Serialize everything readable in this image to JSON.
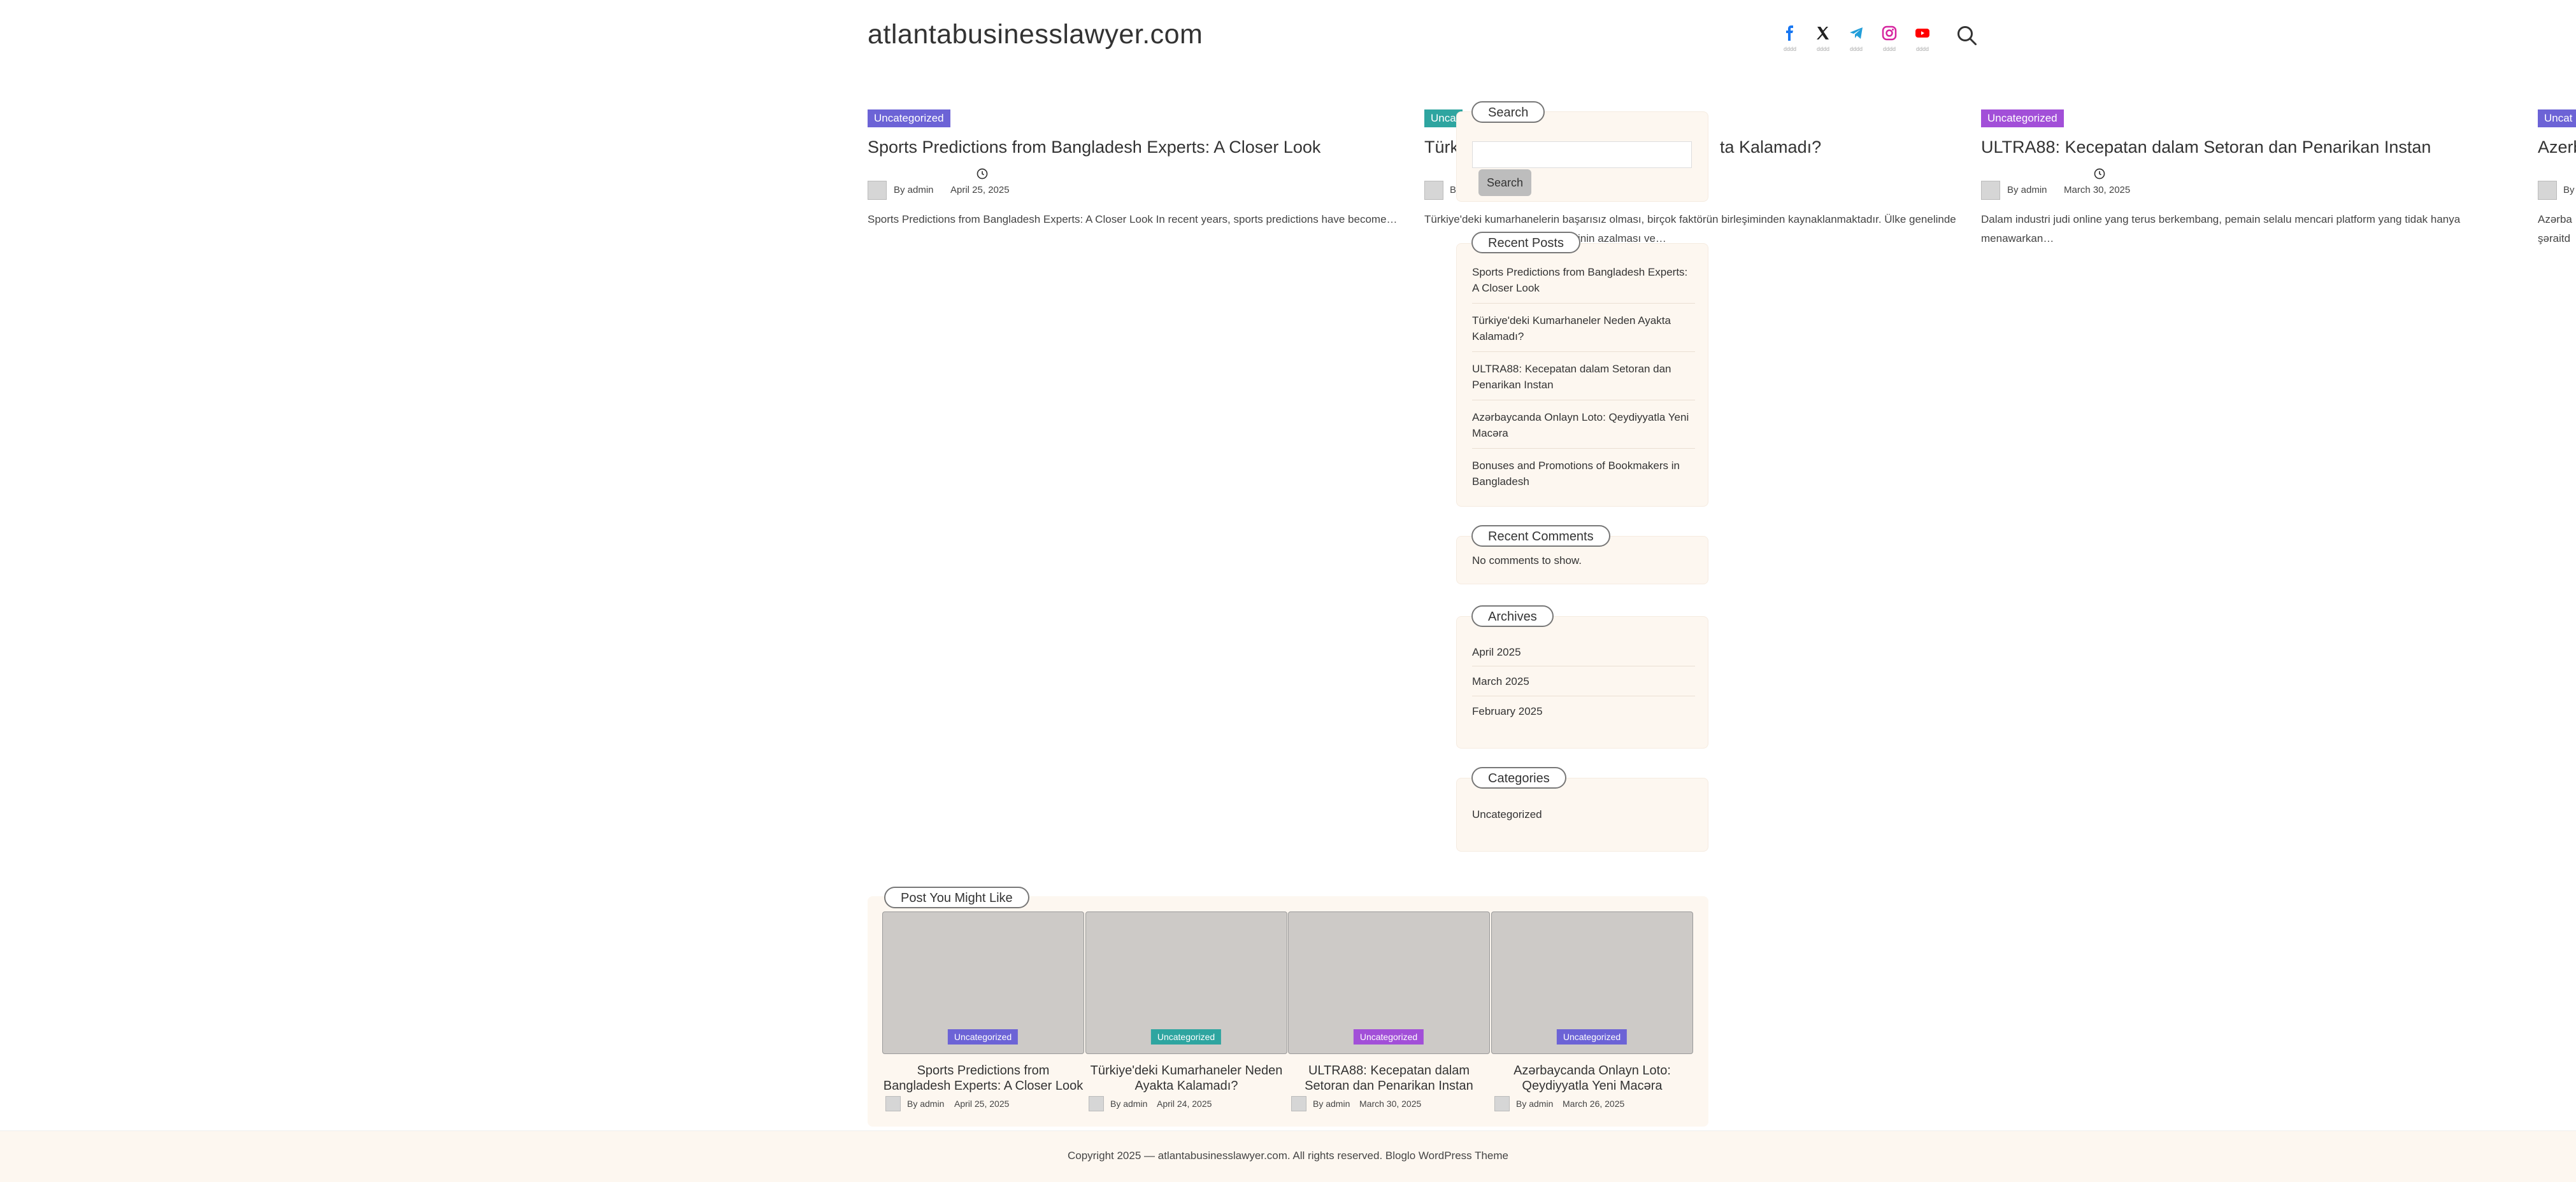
{
  "site": {
    "title": "atlantabusinesslawyer.com"
  },
  "social": [
    {
      "name": "facebook",
      "icon": "facebook-icon",
      "color": "#1877f2",
      "label": "dddd"
    },
    {
      "name": "x",
      "icon": "x-icon",
      "color": "#222222",
      "label": "dddd"
    },
    {
      "name": "telegram",
      "icon": "telegram-icon",
      "color": "#229ed9",
      "label": "dddd"
    },
    {
      "name": "instagram",
      "icon": "instagram-icon",
      "color": "#d6249f",
      "label": "dddd"
    },
    {
      "name": "youtube",
      "icon": "youtube-icon",
      "color": "#ff0000",
      "label": "dddd"
    }
  ],
  "posts": [
    {
      "category": "Uncategorized",
      "category_color": "#6c63d6",
      "title": "Sports Predictions from Bangladesh Experts: A Closer Look",
      "author": "By admin",
      "date": "April 25, 2025",
      "excerpt": "Sports Predictions from Bangladesh Experts: A Closer Look In recent years, sports predictions have become…"
    },
    {
      "category": "Unca",
      "category_color": "#2ea5a0",
      "title": "Türk",
      "title_tail": "ta Kalamadı?",
      "author": "B",
      "date": "",
      "excerpt": "Türkiye'deki kumarhanelerin başarısız olması, birçok faktörün birleşiminden kaynaklanmaktadır. Ülke genelinde",
      "excerpt_tail": "ilainin azalması ve…"
    },
    {
      "category": "Uncategorized",
      "category_color": "#a24fd8",
      "title": "ULTRA88: Kecepatan dalam Setoran dan Penarikan Instan",
      "author": "By admin",
      "date": "March 30, 2025",
      "excerpt": "Dalam industri judi online yang terus berkembang, pemain selalu mencari platform yang tidak hanya menawarkan…"
    },
    {
      "category": "Uncat",
      "category_color": "#6c63d6",
      "title": "Azerb",
      "author": "By",
      "excerpt": "Azərba",
      "excerpt2": "şəraitd"
    }
  ],
  "sidebar": {
    "search": {
      "title": "Search",
      "placeholder": "",
      "button": "Search"
    },
    "recent_posts": {
      "title": "Recent Posts",
      "items": [
        "Sports Predictions from Bangladesh Experts: A Closer Look",
        "Türkiye'deki Kumarhaneler Neden Ayakta Kalamadı?",
        "ULTRA88: Kecepatan dalam Setoran dan Penarikan Instan",
        "Azərbaycanda Onlayn Loto: Qeydiyyatla Yeni Macəra",
        "Bonuses and Promotions of Bookmakers in Bangladesh"
      ]
    },
    "recent_comments": {
      "title": "Recent Comments",
      "empty": "No comments to show."
    },
    "archives": {
      "title": "Archives",
      "items": [
        "April 2025",
        "March 2025",
        "February 2025"
      ]
    },
    "categories": {
      "title": "Categories",
      "items": [
        "Uncategorized"
      ]
    }
  },
  "related": {
    "title": "Post You Might Like",
    "items": [
      {
        "category": "Uncategorized",
        "category_color": "#6c63d6",
        "title": "Sports Predictions from Bangladesh Experts: A Closer Look",
        "author": "By admin",
        "date": "April 25, 2025"
      },
      {
        "category": "Uncategorized",
        "category_color": "#2ea5a0",
        "title": "Türkiye'deki Kumarhaneler Neden Ayakta Kalamadı?",
        "author": "By admin",
        "date": "April 24, 2025"
      },
      {
        "category": "Uncategorized",
        "category_color": "#a24fd8",
        "title": "ULTRA88: Kecepatan dalam Setoran dan Penarikan Instan",
        "author": "By admin",
        "date": "March 30, 2025"
      },
      {
        "category": "Uncategorized",
        "category_color": "#6c63d6",
        "title": "Azərbaycanda Onlayn Loto: Qeydiyyatla Yeni Macəra",
        "author": "By admin",
        "date": "March 26, 2025"
      }
    ]
  },
  "footer": {
    "text": "Copyright 2025 — atlantabusinesslawyer.com. All rights reserved. Bloglo WordPress Theme"
  }
}
